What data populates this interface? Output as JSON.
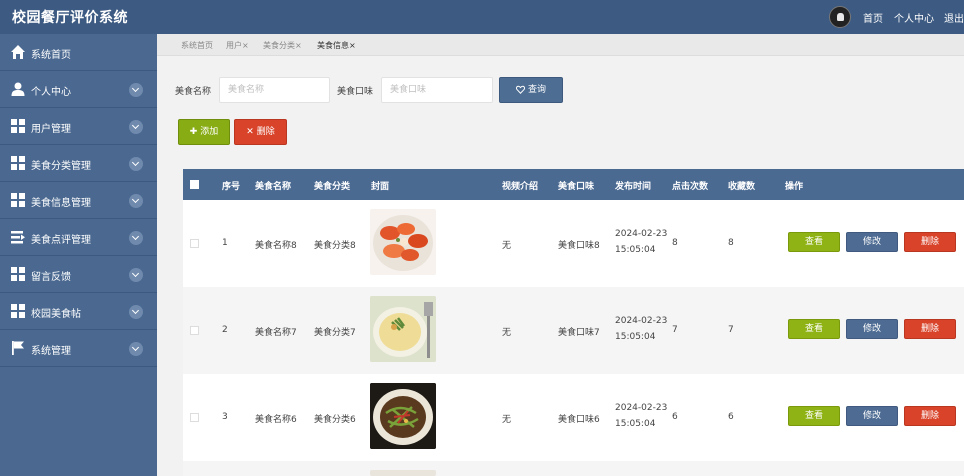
{
  "app": {
    "title": "校园餐厅评价系统"
  },
  "topnav": {
    "home": "首页",
    "profile": "个人中心",
    "logout": "退出"
  },
  "sidebar": {
    "items": [
      {
        "label": "系统首页",
        "icon": "home-icon"
      },
      {
        "label": "个人中心",
        "icon": "user-icon"
      },
      {
        "label": "用户管理",
        "icon": "grid-icon"
      },
      {
        "label": "美食分类管理",
        "icon": "grid-icon"
      },
      {
        "label": "美食信息管理",
        "icon": "grid-icon"
      },
      {
        "label": "美食点评管理",
        "icon": "list-arrow-icon"
      },
      {
        "label": "留言反馈",
        "icon": "grid-icon"
      },
      {
        "label": "校园美食帖",
        "icon": "grid-icon"
      },
      {
        "label": "系统管理",
        "icon": "flag-icon"
      }
    ]
  },
  "tabs": [
    "系统首页",
    "用户",
    "美食分类",
    "美食信息"
  ],
  "tab_close": "×",
  "search": {
    "name_label": "美食名称",
    "name_placeholder": "美食名称",
    "taste_label": "美食口味",
    "taste_placeholder": "美食口味",
    "query_button": "查询"
  },
  "actions": {
    "add": "添加",
    "delete": "删除"
  },
  "table": {
    "headers": [
      "序号",
      "美食名称",
      "美食分类",
      "封面",
      "视频介绍",
      "美食口味",
      "发布时间",
      "点击次数",
      "收藏数",
      "操作"
    ],
    "rows": [
      {
        "index": "1",
        "name": "美食名称8",
        "category": "美食分类8",
        "video": "无",
        "taste": "美食口味8",
        "date": "2024-02-23",
        "time": "15:05:04",
        "clicks": "8",
        "favorites": "8"
      },
      {
        "index": "2",
        "name": "美食名称7",
        "category": "美食分类7",
        "video": "无",
        "taste": "美食口味7",
        "date": "2024-02-23",
        "time": "15:05:04",
        "clicks": "7",
        "favorites": "7"
      },
      {
        "index": "3",
        "name": "美食名称6",
        "category": "美食分类6",
        "video": "无",
        "taste": "美食口味6",
        "date": "2024-02-23",
        "time": "15:05:04",
        "clicks": "6",
        "favorites": "6"
      }
    ],
    "row_actions": {
      "view": "查看",
      "edit": "修改",
      "delete": "删除"
    }
  },
  "colors": {
    "header": "#3c5a82",
    "sidebar": "#4a6890",
    "view": "#8fb214",
    "edit": "#4e6c93",
    "delete": "#d8432a"
  }
}
